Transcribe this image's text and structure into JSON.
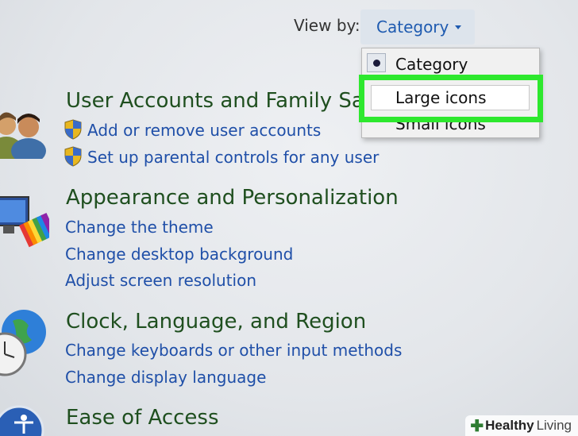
{
  "view_by": {
    "label": "View by:",
    "selected": "Category"
  },
  "dropdown": {
    "options": [
      {
        "label": "Category",
        "checked": true
      },
      {
        "label": "Large icons",
        "hovered": true
      },
      {
        "label": "Small icons"
      }
    ]
  },
  "sections": [
    {
      "title": "User Accounts and Family Sa",
      "icon": "users-icon",
      "links": [
        "Add or remove user accounts",
        "Set up parental controls for any user"
      ]
    },
    {
      "title": "Appearance and Personalization",
      "icon": "appearance-monitor-icon",
      "links": [
        "Change the theme",
        "Change desktop background",
        "Adjust screen resolution"
      ]
    },
    {
      "title": "Clock, Language, and Region",
      "icon": "clock-globe-icon",
      "links": [
        "Change keyboards or other input methods",
        "Change display language"
      ]
    },
    {
      "title": "Ease of Access",
      "icon": "ease-of-access-icon",
      "links": []
    }
  ],
  "watermark": {
    "brand": "Healthy",
    "suffix": "Living"
  },
  "colors": {
    "highlight": "#2ee82e",
    "link": "#1f4fa8",
    "section_title": "#1f4f1f"
  }
}
